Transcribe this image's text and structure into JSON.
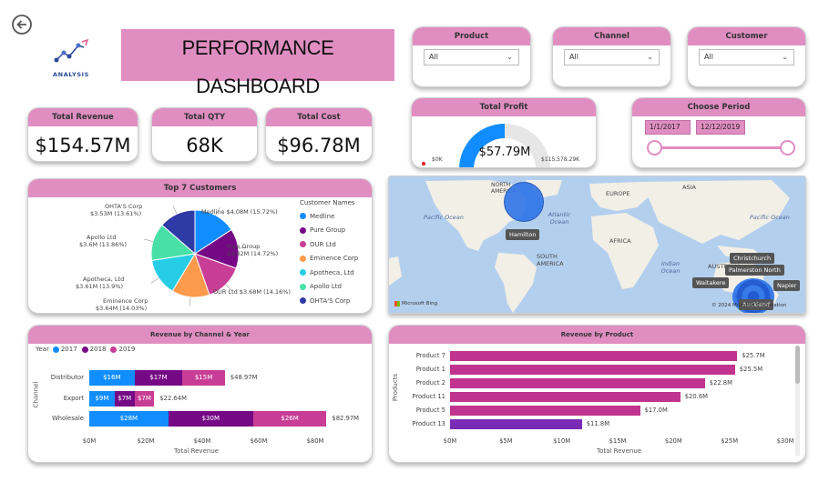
{
  "title": "PERFORMANCE DASHBOARD",
  "logo": {
    "text": "ANALYSIS"
  },
  "filters": {
    "product": {
      "label": "Product",
      "value": "All"
    },
    "channel": {
      "label": "Channel",
      "value": "All"
    },
    "customer": {
      "label": "Customer",
      "value": "All"
    }
  },
  "kpis": {
    "revenue": {
      "label": "Total Revenue",
      "value": "$154.57M"
    },
    "qty": {
      "label": "Total QTY",
      "value": "68K"
    },
    "cost": {
      "label": "Total Cost",
      "value": "$96.78M"
    }
  },
  "profit": {
    "label": "Total Profit",
    "value": "$57.79M",
    "min": "$0K",
    "max": "$115,578.29K",
    "fraction": 0.5
  },
  "period": {
    "label": "Choose Period",
    "start": "1/1/2017",
    "end": "12/12/2019"
  },
  "customers": {
    "title": "Top 7 Customers",
    "legend_title": "Customer Names",
    "slices": [
      {
        "name": "Medline",
        "label": "Medline $4.08M (15.72%)",
        "color": "#118dff"
      },
      {
        "name": "Pure Group",
        "label": "Pure Group $3.82M (14.72%)",
        "color": "#750985"
      },
      {
        "name": "OUR Ltd",
        "label": "OUR Ltd $3.68M (14.16%)",
        "color": "#c83d95"
      },
      {
        "name": "Eminence Corp",
        "label": "Eminence Corp $3.64M (14.03%)",
        "color": "#fd9a4c"
      },
      {
        "name": "Apotheca, Ltd",
        "label": "Apotheca, Ltd $3.61M (13.9%)",
        "color": "#27cde4"
      },
      {
        "name": "Apollo Ltd",
        "label": "Apollo Ltd $3.6M (13.86%)",
        "color": "#48e0a6"
      },
      {
        "name": "OHTA'S Corp",
        "label": "OHTA'S Corp $3.53M (13.61%)",
        "color": "#2e3ba6"
      }
    ]
  },
  "map": {
    "labels": [
      "NORTH AMERICA",
      "EUROPE",
      "ASIA",
      "AFRICA",
      "SOUTH AMERICA",
      "AUSTRALIA",
      "Pacific Ocean",
      "Pacific Ocean",
      "Atlantic Ocean",
      "Indian Ocean"
    ],
    "cities": [
      "Hamilton",
      "Christchurch",
      "Palmerston North",
      "Napier",
      "Waitakere",
      "Auckland"
    ],
    "attribution": "Microsoft Bing",
    "copyright": "© 2024 Microsoft Corporation"
  },
  "channel_chart": {
    "title": "Revenue by Channel & Year",
    "legend_title": "Year",
    "years": [
      {
        "name": "2017",
        "color": "#118dff"
      },
      {
        "name": "2018",
        "color": "#750985"
      },
      {
        "name": "2019",
        "color": "#c83d95"
      }
    ],
    "rows": [
      {
        "name": "Distributor",
        "segments": [
          "$16M",
          "$17M",
          "$15M"
        ],
        "total": "$48.97M"
      },
      {
        "name": "Export",
        "segments": [
          "$9M",
          "$7M",
          "$7M"
        ],
        "total": "$22.64M"
      },
      {
        "name": "Wholesale",
        "segments": [
          "$28M",
          "$30M",
          "$26M"
        ],
        "total": "$82.97M"
      }
    ],
    "ticks": [
      "$0M",
      "$20M",
      "$40M",
      "$60M",
      "$80M"
    ],
    "xlabel": "Total Revenue",
    "ylabel": "Channel"
  },
  "product_chart": {
    "title": "Revenue by Product",
    "xlabel": "Total Revenue",
    "ylabel": "Products",
    "ticks": [
      "$0M",
      "$5M",
      "$10M",
      "$15M",
      "$20M",
      "$25M",
      "$30M"
    ],
    "rows": [
      {
        "name": "Product 7",
        "label": "$25.7M"
      },
      {
        "name": "Product 1",
        "label": "$25.5M"
      },
      {
        "name": "Product 2",
        "label": "$22.8M"
      },
      {
        "name": "Product 11",
        "label": "$20.6M"
      },
      {
        "name": "Product 5",
        "label": "$17.0M"
      },
      {
        "name": "Product 13",
        "label": "$11.8M"
      }
    ]
  },
  "chart_data": [
    {
      "type": "pie",
      "title": "Top 7 Customers",
      "categories": [
        "Medline",
        "Pure Group",
        "OUR Ltd",
        "Eminence Corp",
        "Apotheca, Ltd",
        "Apollo Ltd",
        "OHTA'S Corp"
      ],
      "values": [
        4.08,
        3.82,
        3.68,
        3.64,
        3.61,
        3.6,
        3.53
      ],
      "percent": [
        15.72,
        14.72,
        14.16,
        14.03,
        13.9,
        13.86,
        13.61
      ]
    },
    {
      "type": "bar",
      "title": "Revenue by Channel & Year",
      "categories": [
        "Distributor",
        "Export",
        "Wholesale"
      ],
      "series": [
        {
          "name": "2017",
          "values": [
            16,
            9,
            28
          ]
        },
        {
          "name": "2018",
          "values": [
            17,
            7,
            30
          ]
        },
        {
          "name": "2019",
          "values": [
            15,
            7,
            26
          ]
        }
      ],
      "totals": [
        48.97,
        22.64,
        82.97
      ],
      "xlabel": "Total Revenue",
      "ylabel": "Channel",
      "xlim": [
        0,
        80
      ]
    },
    {
      "type": "bar",
      "title": "Revenue by Product",
      "categories": [
        "Product 7",
        "Product 1",
        "Product 2",
        "Product 11",
        "Product 5",
        "Product 13"
      ],
      "values": [
        25.7,
        25.5,
        22.8,
        20.6,
        17.0,
        11.8
      ],
      "xlabel": "Total Revenue",
      "ylabel": "Products",
      "xlim": [
        0,
        30
      ]
    }
  ],
  "colors": {
    "accent": "#e08ec2",
    "blue": "#118dff",
    "purple": "#750985",
    "magenta": "#c83d95"
  }
}
